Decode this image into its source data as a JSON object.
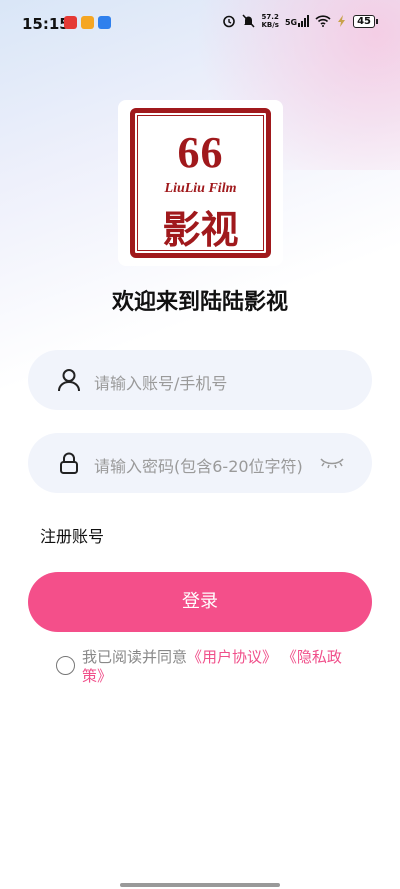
{
  "status_bar": {
    "time": "15:15",
    "net_speed_value": "57.2",
    "net_speed_unit": "KB/s",
    "network": "5G",
    "battery": "45"
  },
  "logo": {
    "number": "66",
    "sub": "LiuLiu Film",
    "cn": "影视"
  },
  "welcome_title": "欢迎来到陆陆影视",
  "account_field": {
    "placeholder": "请输入账号/手机号",
    "icon": "user-icon"
  },
  "password_field": {
    "placeholder": "请输入密码(包含6-20位字符)",
    "icon": "lock-icon",
    "toggle_icon": "eye-closed-icon"
  },
  "register_label": "注册账号",
  "login_button": "登录",
  "agreement": {
    "prefix": "我已阅读并同意",
    "user_agreement": "《用户协议》",
    "privacy_policy": "《隐私政策》"
  },
  "colors": {
    "accent": "#f44f8a",
    "logo_red": "#a0191c",
    "field_bg": "#f1f4fb"
  }
}
